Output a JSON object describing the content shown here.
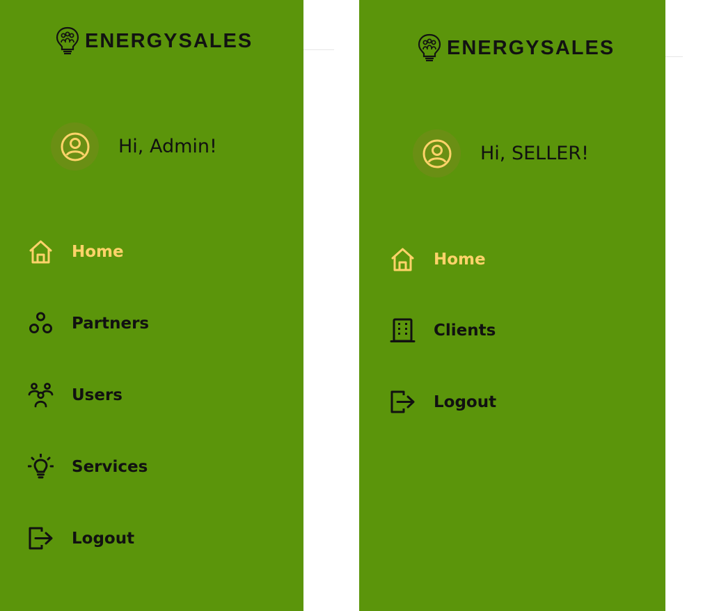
{
  "colors": {
    "sidebar_bg": "#5b950b",
    "accent": "#ffd36a",
    "avatar_bg": "#6a8f14",
    "text": "#111111"
  },
  "admin_panel": {
    "logo_text": "ENERGYSALES",
    "logo_icon": "lightbulb-people-icon",
    "greeting": "Hi, Admin!",
    "avatar_icon": "user-circle-icon",
    "menu": [
      {
        "label": "Home",
        "icon": "home-icon",
        "active": true
      },
      {
        "label": "Partners",
        "icon": "partners-icon",
        "active": false
      },
      {
        "label": "Users",
        "icon": "users-icon",
        "active": false
      },
      {
        "label": "Services",
        "icon": "lightbulb-icon",
        "active": false
      },
      {
        "label": "Logout",
        "icon": "logout-icon",
        "active": false
      }
    ]
  },
  "seller_panel": {
    "logo_text": "ENERGYSALES",
    "logo_icon": "lightbulb-people-icon",
    "greeting": "Hi, SELLER!",
    "avatar_icon": "user-circle-icon",
    "menu": [
      {
        "label": "Home",
        "icon": "home-icon",
        "active": true
      },
      {
        "label": "Clients",
        "icon": "building-icon",
        "active": false
      },
      {
        "label": "Logout",
        "icon": "logout-icon",
        "active": false
      }
    ]
  }
}
